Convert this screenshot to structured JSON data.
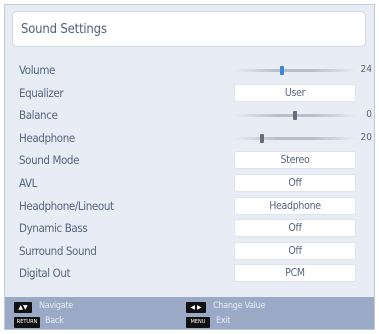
{
  "title": "Sound Settings",
  "settings": [
    {
      "label": "Volume",
      "type": "slider",
      "value": "24",
      "level_pct": 39,
      "thumb_color": "#3d86d8"
    },
    {
      "label": "Equalizer",
      "type": "select",
      "value": "User"
    },
    {
      "label": "Balance",
      "type": "slider",
      "value": "0",
      "level_pct": 50,
      "thumb_color": "#666e7a"
    },
    {
      "label": "Headphone",
      "type": "slider",
      "value": "20",
      "level_pct": 22,
      "thumb_color": "#666e7a"
    },
    {
      "label": "Sound Mode",
      "type": "select",
      "value": "Stereo"
    },
    {
      "label": "AVL",
      "type": "select",
      "value": "Off"
    },
    {
      "label": "Headphone/Lineout",
      "type": "select",
      "value": "Headphone"
    },
    {
      "label": "Dynamic Bass",
      "type": "select",
      "value": "Off"
    },
    {
      "label": "Surround Sound",
      "type": "select",
      "value": "Off"
    },
    {
      "label": "Digital Out",
      "type": "select",
      "value": "PCM"
    }
  ],
  "footer": {
    "navigate": {
      "key": "▲▼",
      "text": "Navigate"
    },
    "change": {
      "key": "◀ ▶",
      "text": "Change Value"
    },
    "back": {
      "key": "RETURN",
      "text": "Back"
    },
    "exit": {
      "key": "MENU",
      "text": "Exit"
    }
  },
  "colors": {
    "panel_bg": "#e7ecf5",
    "footer_bg": "#9aa9c6",
    "text": "#56667f",
    "accent": "#3d86d8"
  }
}
